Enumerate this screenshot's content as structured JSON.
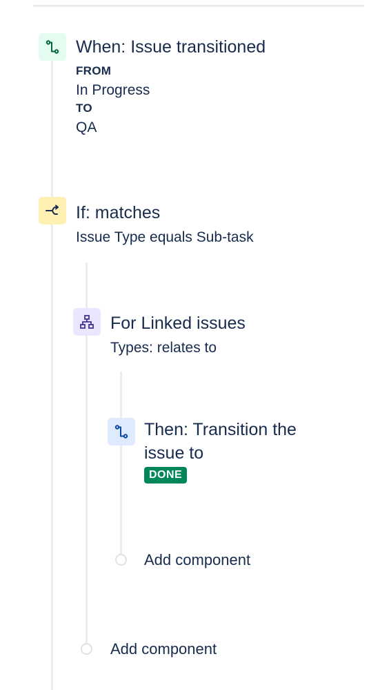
{
  "trigger": {
    "icon": "branch-arrow-icon",
    "title": "When: Issue transitioned",
    "from_label": "FROM",
    "from_value": "In Progress",
    "to_label": "TO",
    "to_value": "QA"
  },
  "condition": {
    "icon": "condition-fork-icon",
    "title": "If: matches",
    "description": "Issue Type equals Sub-task"
  },
  "branch": {
    "icon": "hierarchy-icon",
    "title": "For Linked issues",
    "description": "Types: relates to"
  },
  "action": {
    "icon": "transition-icon",
    "title_line1": "Then: Transition the",
    "title_line2": "issue to",
    "status": "DONE"
  },
  "add_component_inner": "Add component",
  "add_component_outer": "Add component",
  "colors": {
    "text": "#172b4d",
    "line": "#ebecf0",
    "done_lozenge": "#00875a",
    "trigger_bg": "#e3fcef",
    "condition_bg": "#fff0b3",
    "branch_bg": "#eae6ff",
    "action_bg": "#deebff"
  }
}
